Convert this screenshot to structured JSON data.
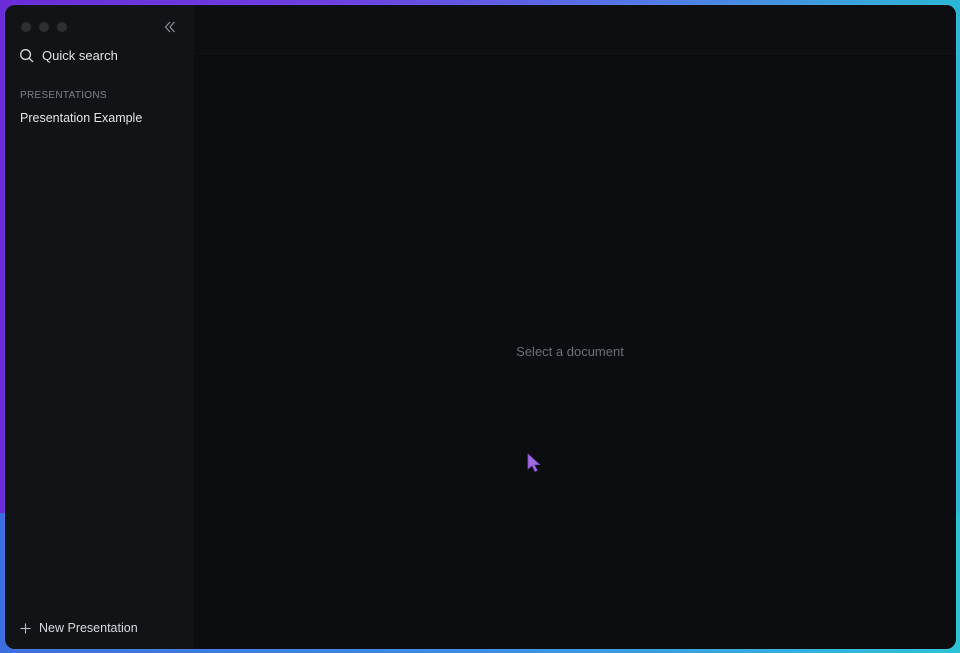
{
  "window": {
    "traffic_lights": [
      "close",
      "minimize",
      "zoom"
    ]
  },
  "sidebar": {
    "collapse_icon": "double-chevron-left-icon",
    "quick_search": {
      "icon": "search-icon",
      "label": "Quick search"
    },
    "section_title": "PRESENTATIONS",
    "items": [
      {
        "label": "Presentation Example"
      }
    ],
    "new_button": {
      "icon": "plus-icon",
      "label": "New Presentation"
    }
  },
  "main": {
    "empty_state": "Select a document"
  },
  "colors": {
    "accent_cursor": "#a06be0",
    "sidebar_bg": "#111316",
    "main_bg": "#0c0d10"
  }
}
